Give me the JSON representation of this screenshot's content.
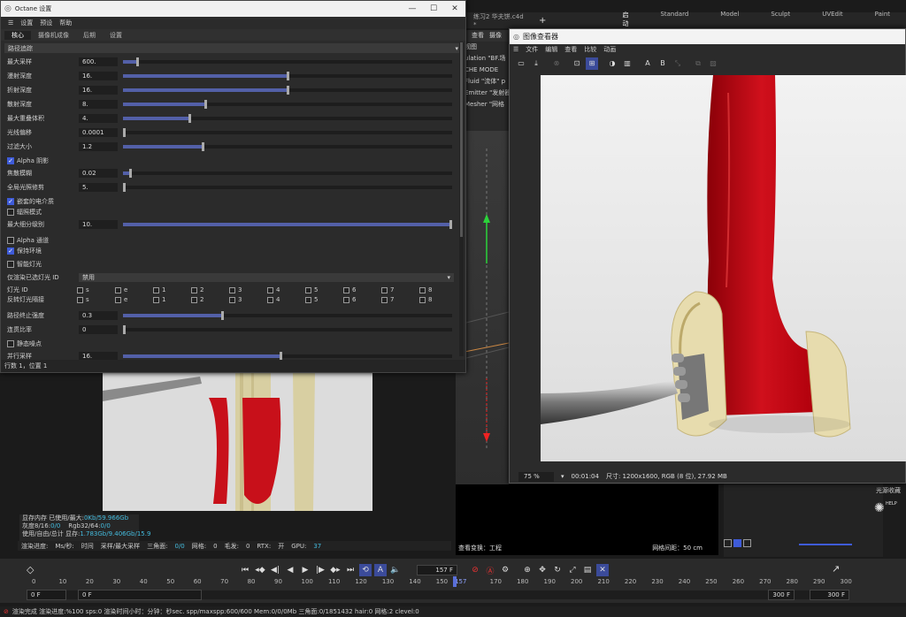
{
  "c4d": {
    "doc_tab": "练习2 华夫饼.c4d *",
    "add_tab": "+",
    "layouts": [
      "启动",
      "Standard",
      "Model",
      "Sculpt",
      "UVEdit",
      "Paint"
    ],
    "active_layout": "启动",
    "side_lines": [
      "视图",
      "ulation \"BF.场",
      "CHE MODE",
      "Fluid \"流体\" p",
      "Emitter \"发射器",
      "Mesher \"网格"
    ],
    "side_tabs": [
      "查看",
      "摄像"
    ]
  },
  "octane": {
    "title": "Octane 设置",
    "menu": [
      "设置",
      "预设",
      "帮助"
    ],
    "tabs": [
      "核心",
      "摄像机成像",
      "后期",
      "设置"
    ],
    "active_tab": "核心",
    "section": "路径追踪",
    "rows": [
      {
        "label": "最大采样",
        "value": "600.",
        "frac": 0.04
      },
      {
        "label": "漫射深度",
        "value": "16.",
        "frac": 0.5
      },
      {
        "label": "折射深度",
        "value": "16.",
        "frac": 0.5
      },
      {
        "label": "散射深度",
        "value": "8.",
        "frac": 0.25
      },
      {
        "label": "最大重叠体积",
        "value": "4.",
        "frac": 0.2
      },
      {
        "label": "光线偏移",
        "value": "0.0001",
        "frac": 0.0
      },
      {
        "label": "过滤大小",
        "value": "1.2",
        "frac": 0.24
      }
    ],
    "alpha_shadow": "Alpha 阴影",
    "rows2": [
      {
        "label": "焦散模糊",
        "value": "0.02",
        "frac": 0.02
      },
      {
        "label": "全局光照修剪",
        "value": "5.",
        "frac": 0.0
      }
    ],
    "nested": "嵌套的电介质",
    "irradiance": "辐照模式",
    "row3": {
      "label": "最大细分级别",
      "value": "10.",
      "frac": 1.0
    },
    "alpha_channel": "Alpha 通道",
    "keep_env": "保持环境",
    "ai_light": "智能灯光",
    "light_id_label": "仅渲染已选灯光 ID",
    "light_id_value": "禁用",
    "light_rows": [
      {
        "label": "灯光 ID",
        "cells": [
          "s",
          "e",
          "1",
          "2",
          "3",
          "4",
          "5",
          "6",
          "7",
          "8"
        ]
      },
      {
        "label": "反转灯光隔接",
        "cells": [
          "s",
          "e",
          "1",
          "2",
          "3",
          "4",
          "5",
          "6",
          "7",
          "8"
        ]
      }
    ],
    "rows4": [
      {
        "label": "路径终止强度",
        "value": "0.3",
        "frac": 0.3
      },
      {
        "label": "连贯比率",
        "value": "0",
        "frac": 0.0
      }
    ],
    "static_noise": "静态噪点",
    "parallel": {
      "label": "并行采样",
      "value": "16.",
      "frac": 0.48
    },
    "status": "行数 1，位置 1"
  },
  "viewer": {
    "title": "图像查看器",
    "menu": [
      "文件",
      "编辑",
      "查看",
      "比较",
      "动画"
    ],
    "tool_letters": [
      "A",
      "B"
    ],
    "zoom": "75 %",
    "time": "00:01:04",
    "info": "尺寸: 1200x1600, RGB (8 位), 27.92 MB"
  },
  "left_info": {
    "lines": [
      [
        "显存内存 已使用/最大:",
        "0Kb/59.966Gb"
      ],
      [
        "灰度8/16:",
        "0/0",
        "Rgb32/64:",
        "0/0"
      ],
      [
        "使用/自由/总计 显存:",
        "1.783Gb/9.406Gb/15.9"
      ]
    ]
  },
  "render_status": [
    "渲染进度:",
    "Ms/秒:",
    "时间",
    "采样/最大采样",
    "三角面:",
    "0/0",
    "网格:",
    "0",
    "毛发:",
    "0",
    "RTX:",
    "开",
    "GPU:",
    "37"
  ],
  "viewport_info": {
    "transform": "查看变换：工程",
    "grid": "网格间距：50 cm"
  },
  "right_panel": {
    "label": "光源收藏",
    "help": "HELP"
  },
  "timeline": {
    "current_frame": "157 F",
    "start": "0 F",
    "start2": "0 F",
    "end": "300 F",
    "end2": "300 F",
    "ticks": [
      "0",
      "10",
      "20",
      "30",
      "40",
      "50",
      "60",
      "70",
      "80",
      "90",
      "100",
      "110",
      "120",
      "130",
      "140",
      "150",
      "157",
      "170",
      "180",
      "190",
      "200",
      "210",
      "220",
      "230",
      "240",
      "250",
      "260",
      "270",
      "280",
      "290",
      "300"
    ]
  },
  "bottom_status": "渲染完成  渲染进度:%100 sps:0 渲染时间小时：分钟：秒sec. spp/maxspp:600/600 Mem:0/0/0Mb 三角面:0/1851432 hair:0 网格:2 clevel:0",
  "colors": {
    "accent": "#3e5bd8",
    "slider_fill": "#5360a8",
    "sauce": "#c8101a"
  }
}
